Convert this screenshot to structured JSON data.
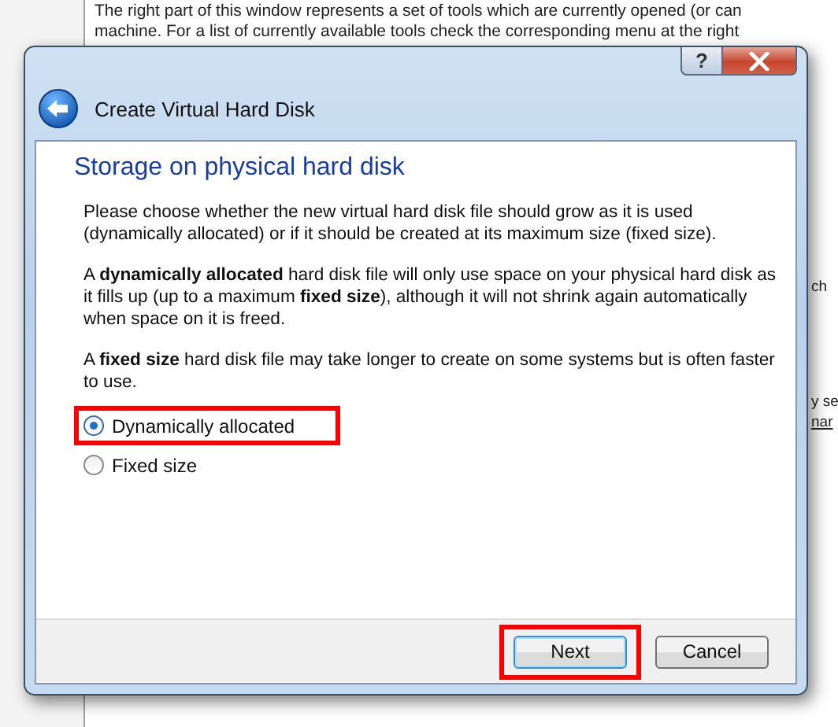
{
  "background": {
    "lines": [
      "The right part of this window represents a set of tools which are currently opened (or can",
      "machine. For a list of currently available tools check the corresponding menu at the right"
    ],
    "side_fragments": [
      {
        "text": "ch",
        "link": false
      },
      {
        "text": "y se",
        "link": false
      },
      {
        "text": "nar",
        "link": true
      }
    ]
  },
  "dialog": {
    "title": "Create Virtual Hard Disk",
    "help_label": "?",
    "heading": "Storage on physical hard disk",
    "paragraphs": [
      "Please choose whether the new virtual hard disk file should grow as it is used (dynamically allocated) or if it should be created at its maximum size (fixed size).",
      "A **dynamically allocated** hard disk file will only use space on your physical hard disk as it fills up (up to a maximum **fixed size**), although it will not shrink again automatically when space on it is freed.",
      "A **fixed size** hard disk file may take longer to create on some systems but is often faster to use."
    ],
    "options": [
      {
        "label": "Dynamically allocated",
        "selected": true,
        "annotated": true
      },
      {
        "label": "Fixed size",
        "selected": false,
        "annotated": false
      }
    ],
    "buttons": [
      {
        "label": "Next",
        "default": true,
        "annotated": true
      },
      {
        "label": "Cancel",
        "default": false,
        "annotated": false
      }
    ]
  }
}
